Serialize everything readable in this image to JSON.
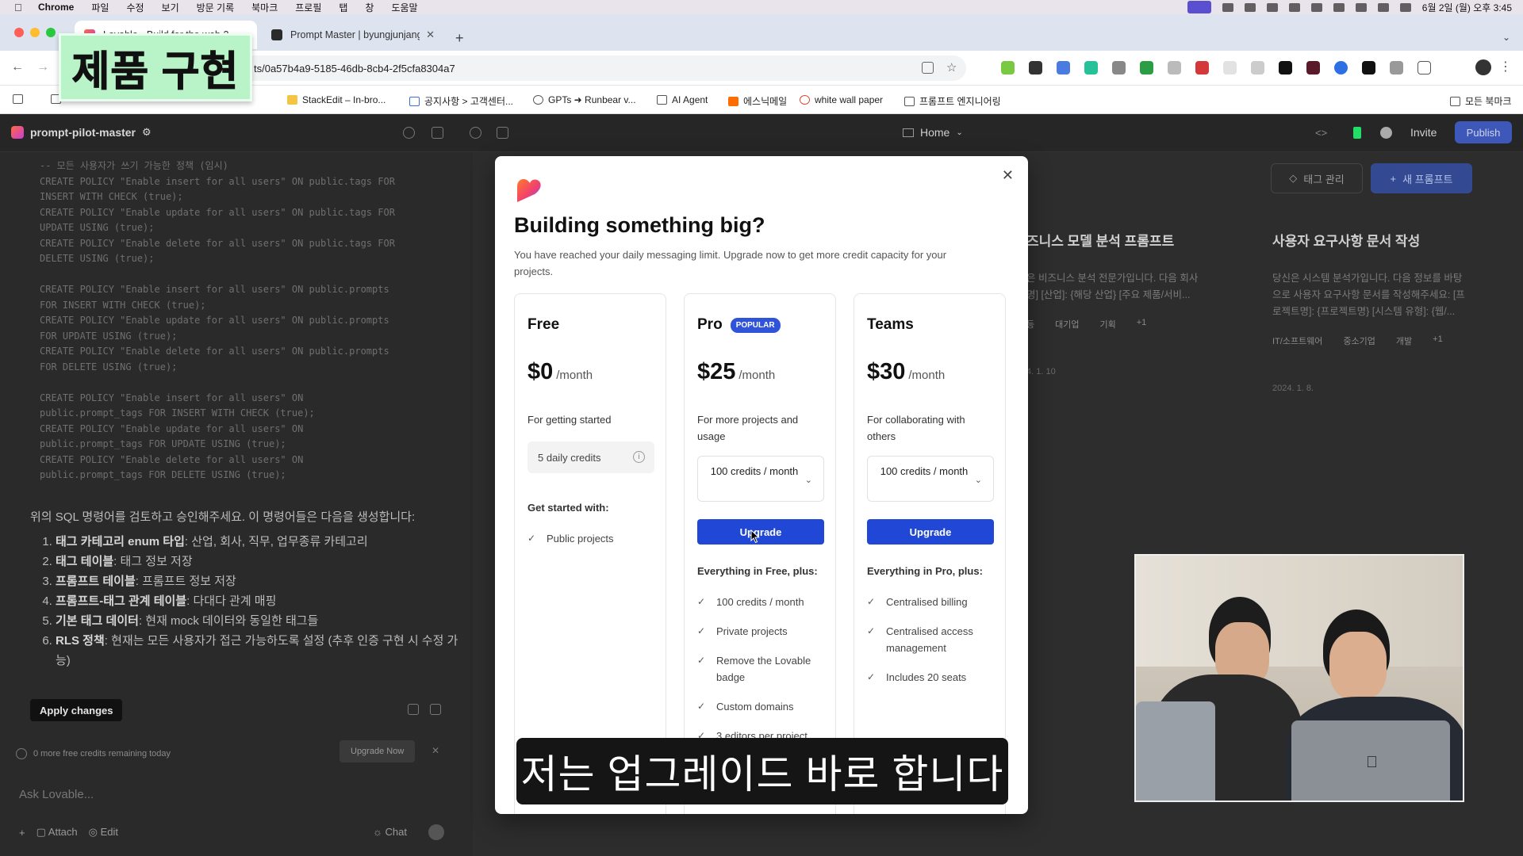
{
  "menubar": {
    "app": "Chrome",
    "items": [
      "파일",
      "수정",
      "보기",
      "방문 기록",
      "북마크",
      "프로필",
      "탭",
      "창",
      "도움말"
    ],
    "clock": "6월 2일 (월) 오후 3:45"
  },
  "tabs": [
    {
      "title": "Lovable - Build for the web 2...",
      "active": true
    },
    {
      "title": "Prompt Master | byungjunjang",
      "active": false
    }
  ],
  "address": {
    "url": "ts/0a57b4a9-5185-46db-8cb4-2f5cfa8304a7"
  },
  "bookmarks": [
    {
      "label": "StackEdit – In-bro..."
    },
    {
      "label": "공지사항 > 고객센터..."
    },
    {
      "label": "GPTs ➜ Runbear v..."
    },
    {
      "label": "AI Agent"
    },
    {
      "label": "에스닉메일"
    },
    {
      "label": "white wall paper"
    },
    {
      "label": "프롬프트 엔지니어링"
    },
    {
      "label": "모든 북마크"
    }
  ],
  "overlay_title": "제품 구현",
  "app": {
    "project": "prompt-pilot-master",
    "home_label": "Home",
    "invite_label": "Invite",
    "publish_label": "Publish",
    "code_lines": [
      "-- 모든 사용자가 쓰기 가능한 정책 (임시)",
      "CREATE POLICY \"Enable insert for all users\" ON public.tags FOR",
      "INSERT WITH CHECK (true);",
      "CREATE POLICY \"Enable update for all users\" ON public.tags FOR",
      "UPDATE USING (true);",
      "CREATE POLICY \"Enable delete for all users\" ON public.tags FOR",
      "DELETE USING (true);",
      "",
      "CREATE POLICY \"Enable insert for all users\" ON public.prompts",
      "FOR INSERT WITH CHECK (true);",
      "CREATE POLICY \"Enable update for all users\" ON public.prompts",
      "FOR UPDATE USING (true);",
      "CREATE POLICY \"Enable delete for all users\" ON public.prompts",
      "FOR DELETE USING (true);",
      "",
      "CREATE POLICY \"Enable insert for all users\" ON",
      "public.prompt_tags FOR INSERT WITH CHECK (true);",
      "CREATE POLICY \"Enable update for all users\" ON",
      "public.prompt_tags FOR UPDATE USING (true);",
      "CREATE POLICY \"Enable delete for all users\" ON",
      "public.prompt_tags FOR DELETE USING (true);"
    ],
    "chat_intro": "위의 SQL 명령어를 검토하고 승인해주세요. 이 명령어들은 다음을 생성합니다:",
    "chat_items": [
      {
        "bold": "태그 카테고리 enum 타입",
        "rest": ": 산업, 회사, 직무, 업무종류 카테고리"
      },
      {
        "bold": "태그 테이블",
        "rest": ": 태그 정보 저장"
      },
      {
        "bold": "프롬프트 테이블",
        "rest": ": 프롬프트 정보 저장"
      },
      {
        "bold": "프롬프트-태그 관계 테이블",
        "rest": ": 다대다 관계 매핑"
      },
      {
        "bold": "기본 태그 데이터",
        "rest": ": 현재 mock 데이터와 동일한 태그들"
      },
      {
        "bold": "RLS 정책",
        "rest": ": 현재는 모든 사용자가 접근 가능하도록 설정 (추후 인증 구현 시 수정 가능)"
      }
    ],
    "apply_label": "Apply changes",
    "credits_text": "0 more free credits remaining today",
    "upgrade_now_label": "Upgrade Now",
    "ask_placeholder": "Ask Lovable...",
    "attach_label": "Attach",
    "edit_label": "Edit",
    "chat_label": "Chat",
    "tag_manage_label": "태그 관리",
    "new_prompt_label": "새 프롬프트",
    "cards": [
      {
        "title": "즈니스 모델 분석 프롬프트",
        "desc": "은 비즈니스 분석 전문가입니다. 다음 회사\n명] [산업]: {해당 산업} [주요 제품/서비...",
        "tags": [
          "등",
          "대기업",
          "기획",
          "+1"
        ],
        "date": "4. 1. 10"
      },
      {
        "title": "사용자 요구사항 문서 작성",
        "desc": "당신은 시스템 분석가입니다. 다음 정보를 바탕\n으로 사용자 요구사항 문서를 작성해주세요: [프\n로젝트명]: {프로젝트명} [시스템 유형]: {웹/...",
        "tags": [
          "IT/소프트웨어",
          "중소기업",
          "개발",
          "+1"
        ],
        "date": "2024. 1. 8."
      }
    ]
  },
  "modal": {
    "title": "Building something big?",
    "subtitle": "You have reached your daily messaging limit. Upgrade now to get more credit capacity for your projects.",
    "plans": [
      {
        "name": "Free",
        "badge": "",
        "price": "$0",
        "per": "/month",
        "desc": "For getting started",
        "credits": "5 daily credits",
        "button": "",
        "features_heading": "Get started with:",
        "features": [
          "Public projects"
        ]
      },
      {
        "name": "Pro",
        "badge": "POPULAR",
        "price": "$25",
        "per": "/month",
        "desc": "For more projects and usage",
        "credits": "100 credits / month",
        "button": "Upgrade",
        "features_heading": "Everything in Free, plus:",
        "features": [
          "100 credits / month",
          "Private projects",
          "Remove the Lovable badge",
          "Custom domains",
          "3 editors per project"
        ]
      },
      {
        "name": "Teams",
        "badge": "",
        "price": "$30",
        "per": "/month",
        "desc": "For collaborating with others",
        "credits": "100 credits / month",
        "button": "Upgrade",
        "features_heading": "Everything in Pro, plus:",
        "features": [
          "Centralised billing",
          "Centralised access management",
          "Includes 20 seats"
        ]
      }
    ]
  },
  "caption": "저는 업그레이드 바로 합니다",
  "colors": {
    "accent": "#2147d6",
    "badge": "#2f54d9",
    "overlay_title_bg": "#b9f3c8"
  }
}
